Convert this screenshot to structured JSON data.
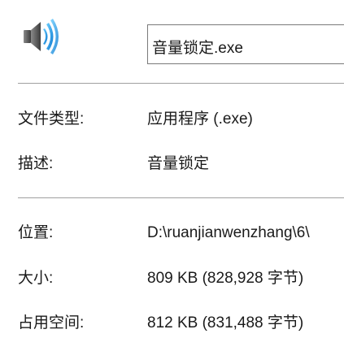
{
  "header": {
    "icon": "speaker-volume-icon",
    "filename": "音量锁定.exe"
  },
  "properties": {
    "file_type": {
      "label": "文件类型:",
      "value": "应用程序 (.exe)"
    },
    "description": {
      "label": "描述:",
      "value": "音量锁定"
    },
    "location": {
      "label": "位置:",
      "value": "D:\\ruanjianwenzhang\\6\\"
    },
    "size": {
      "label": "大小:",
      "value": "809 KB (828,928 字节)"
    },
    "size_on_disk": {
      "label": "占用空间:",
      "value": "812 KB (831,488 字节)"
    }
  },
  "colors": {
    "speaker_dark": "#5a5a5a",
    "wave_blue": "#1e9be8",
    "divider": "#a0a0a0"
  }
}
